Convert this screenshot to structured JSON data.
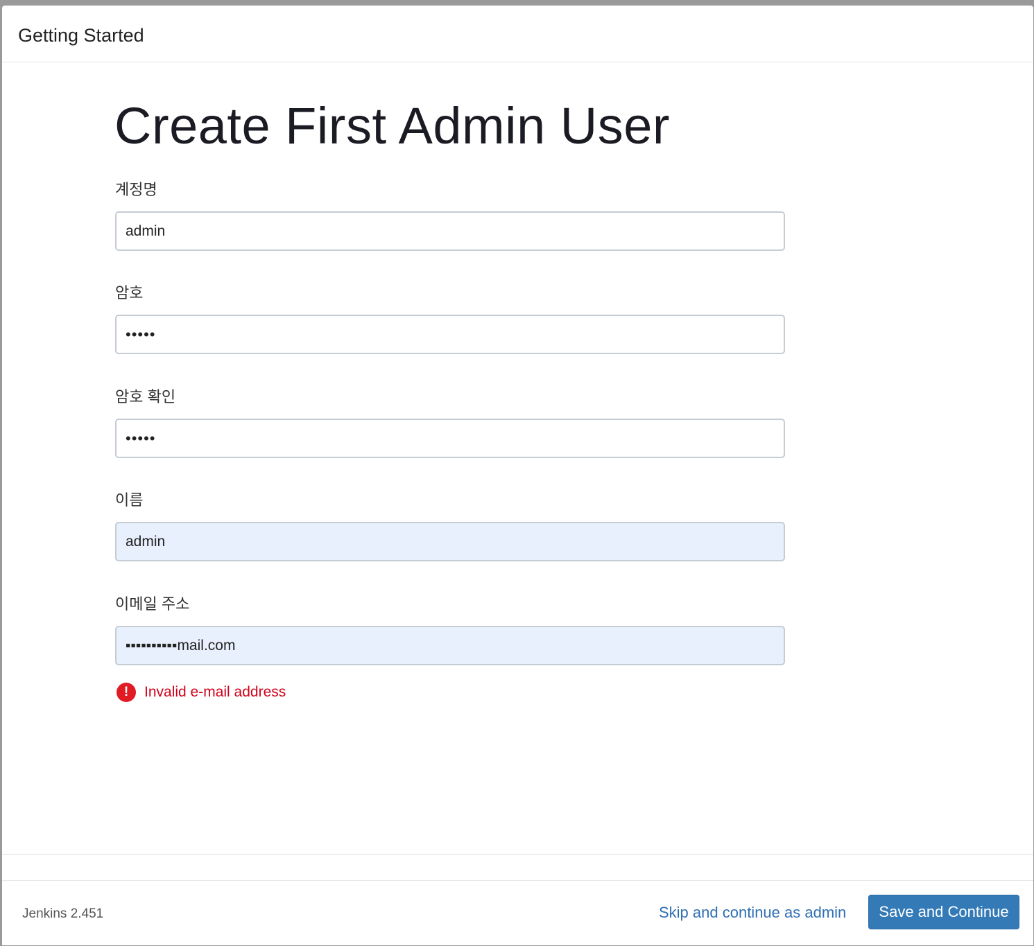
{
  "header": {
    "title": "Getting Started"
  },
  "main": {
    "title": "Create First Admin User",
    "fields": {
      "username": {
        "label": "계정명",
        "value": "admin"
      },
      "password": {
        "label": "암호",
        "value": "•••••"
      },
      "password_confirm": {
        "label": "암호 확인",
        "value": "•••••"
      },
      "fullname": {
        "label": "이름",
        "value": "admin"
      },
      "email": {
        "label": "이메일 주소",
        "value": "▪▪▪▪▪▪▪▪▪▪mail.com"
      }
    },
    "error": {
      "icon": "!",
      "message": "Invalid e-mail address"
    }
  },
  "footer": {
    "version": "Jenkins 2.451",
    "skip_label": "Skip and continue as admin",
    "save_label": "Save and Continue"
  },
  "colors": {
    "primary_button": "#337ab7",
    "link": "#2f6fb3",
    "error": "#d0021b",
    "autofill_background": "#e8f0fe"
  }
}
